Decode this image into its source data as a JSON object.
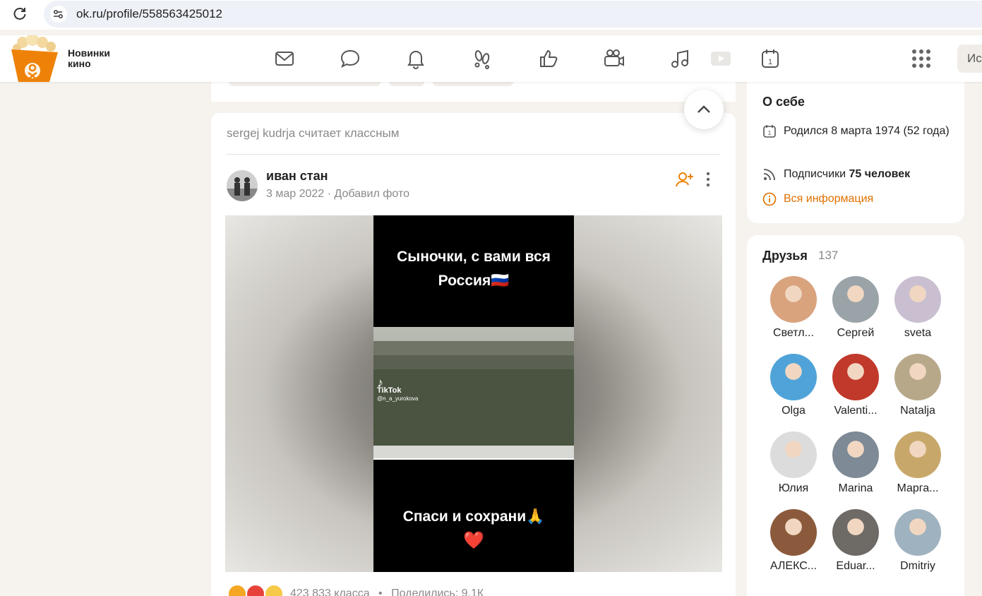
{
  "browser": {
    "url": "ok.ru/profile/558563425012"
  },
  "header": {
    "promo_line1": "Новинки",
    "promo_line2": "кино",
    "search_placeholder": "Ис",
    "nav_icons": [
      "mail-icon",
      "chat-icon",
      "bell-icon",
      "footprints-icon",
      "thumbs-up-icon",
      "video-camera-icon",
      "music-icon",
      "play-icon",
      "calendar-icon"
    ]
  },
  "feed": {
    "liked_by": "sergej kudrja считает классным",
    "post": {
      "author": "иван стан",
      "date": "3 мар 2022",
      "action": "Добавил фото",
      "caption_top_line1": "Сыночки, с вами вся",
      "caption_top_line2": "Россия🇷🇺",
      "caption_bottom": "Спаси и сохрани🙏",
      "caption_heart": "❤️",
      "tiktok_label": "TikTok",
      "tiktok_user": "@n_a_yurokova",
      "likes": "423 833 класса",
      "separator": "•",
      "shares": "Поделились: 9,1К"
    }
  },
  "about": {
    "title": "О себе",
    "born": "Родился 8 марта 1974 (52 года)",
    "subscribers_label": "Подписчики",
    "subscribers_value": "75 человек",
    "all_info": "Вся информация"
  },
  "friends": {
    "title": "Друзья",
    "count": "137",
    "items": [
      {
        "name": "Светл...",
        "color": "#d9a37e"
      },
      {
        "name": "Сергей",
        "color": "#9aa3a8"
      },
      {
        "name": "sveta",
        "color": "#c9bfd0"
      },
      {
        "name": "Olga",
        "color": "#4fa3d9"
      },
      {
        "name": "Valenti...",
        "color": "#c0392b"
      },
      {
        "name": "Natalja",
        "color": "#b8a88a"
      },
      {
        "name": "Юлия",
        "color": "#dcdcdc"
      },
      {
        "name": "Marina",
        "color": "#7e8a96"
      },
      {
        "name": "Марга...",
        "color": "#c8a86a"
      },
      {
        "name": "АЛЕКС...",
        "color": "#8b5a3c"
      },
      {
        "name": "Eduar...",
        "color": "#6e6a66"
      },
      {
        "name": "Dmitriy",
        "color": "#9fb2bf"
      }
    ]
  },
  "colors": {
    "accent": "#ee8208",
    "background": "#f6f3ef"
  }
}
